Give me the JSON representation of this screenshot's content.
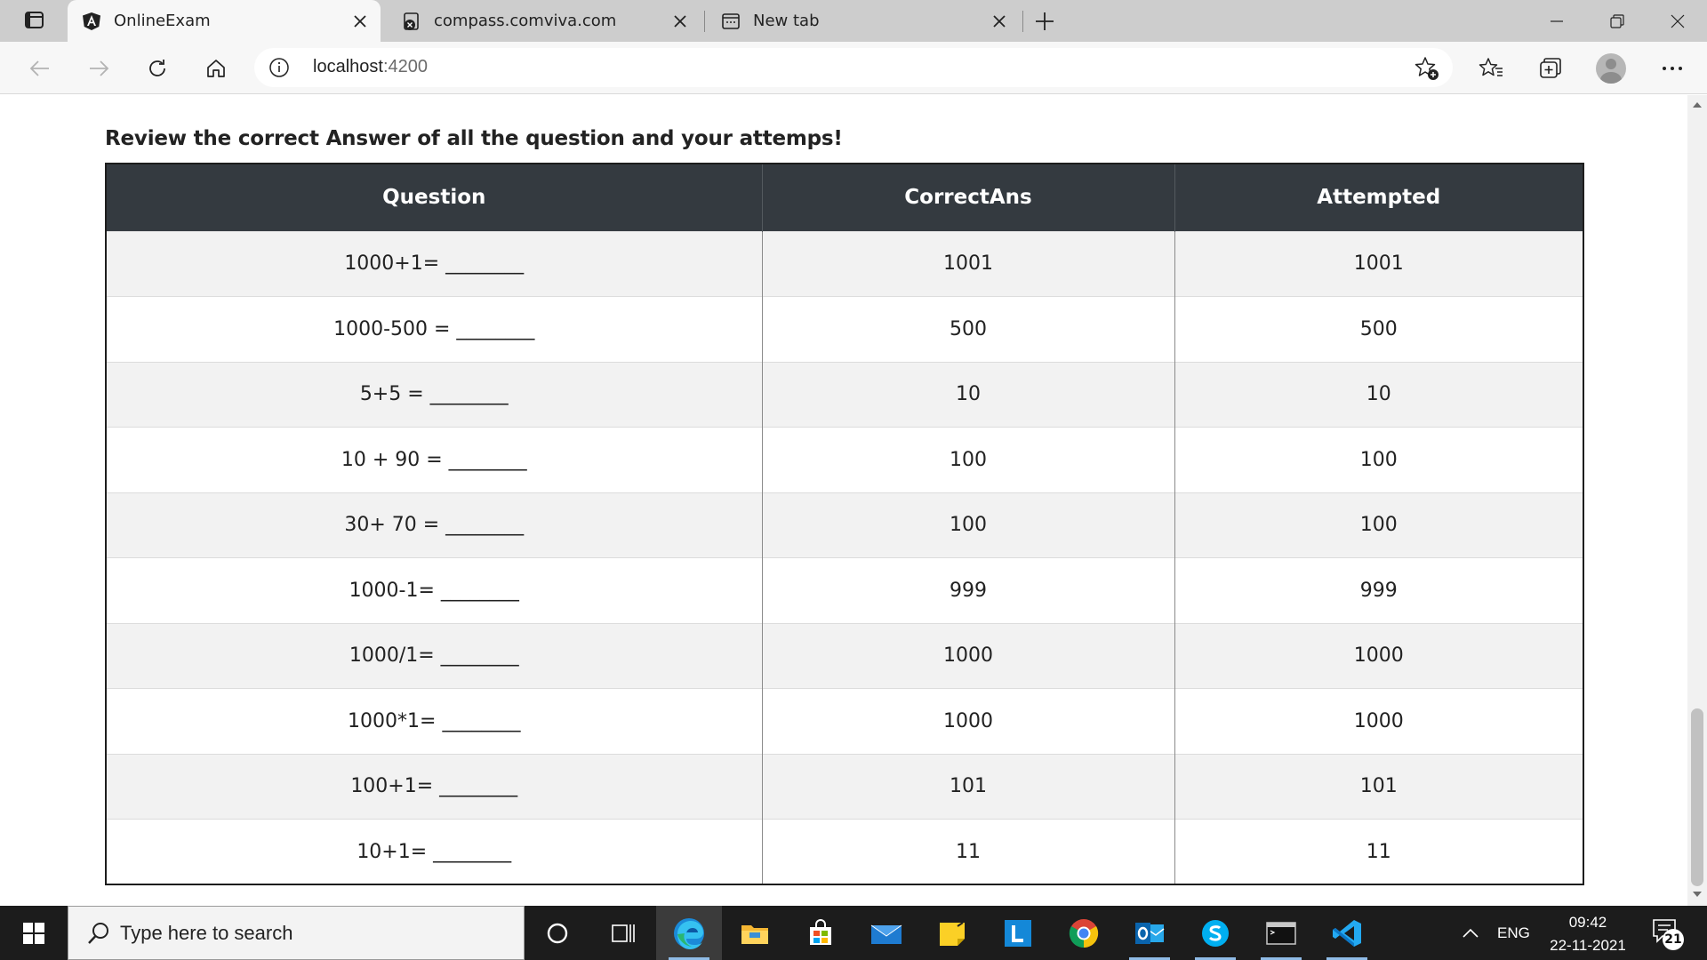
{
  "browser": {
    "tabs": [
      {
        "title": "OnlineExam",
        "icon": "angular-icon",
        "active": true
      },
      {
        "title": "compass.comviva.com",
        "icon": "blocked-site-icon",
        "active": false
      },
      {
        "title": "New tab",
        "icon": "new-tab-icon",
        "active": false
      }
    ],
    "address": {
      "host": "localhost",
      "port": ":4200"
    }
  },
  "page": {
    "heading": "Review the correct Answer of all the question and your attemps!",
    "table": {
      "headers": [
        "Question",
        "CorrectAns",
        "Attempted"
      ],
      "rows": [
        {
          "question": "1000+1= ________",
          "correct": "1001",
          "attempted": "1001"
        },
        {
          "question": "1000-500 = ________",
          "correct": "500",
          "attempted": "500"
        },
        {
          "question": "5+5 = ________",
          "correct": "10",
          "attempted": "10"
        },
        {
          "question": "10 + 90 = ________",
          "correct": "100",
          "attempted": "100"
        },
        {
          "question": "30+ 70 = ________",
          "correct": "100",
          "attempted": "100"
        },
        {
          "question": "1000-1= ________",
          "correct": "999",
          "attempted": "999"
        },
        {
          "question": "1000/1= ________",
          "correct": "1000",
          "attempted": "1000"
        },
        {
          "question": "1000*1= ________",
          "correct": "1000",
          "attempted": "1000"
        },
        {
          "question": "100+1= ________",
          "correct": "101",
          "attempted": "101"
        },
        {
          "question": "10+1= ________",
          "correct": "11",
          "attempted": "11"
        }
      ]
    }
  },
  "taskbar": {
    "search_placeholder": "Type here to search",
    "language": "ENG",
    "time": "09:42",
    "date": "22-11-2021",
    "notification_count": "21",
    "apps": [
      "cortana-icon",
      "task-view-icon",
      "edge-icon",
      "file-explorer-icon",
      "microsoft-store-icon",
      "mail-icon",
      "sticky-notes-icon",
      "l-app-icon",
      "chrome-icon",
      "outlook-icon",
      "skype-icon",
      "terminal-icon",
      "vscode-icon"
    ]
  }
}
